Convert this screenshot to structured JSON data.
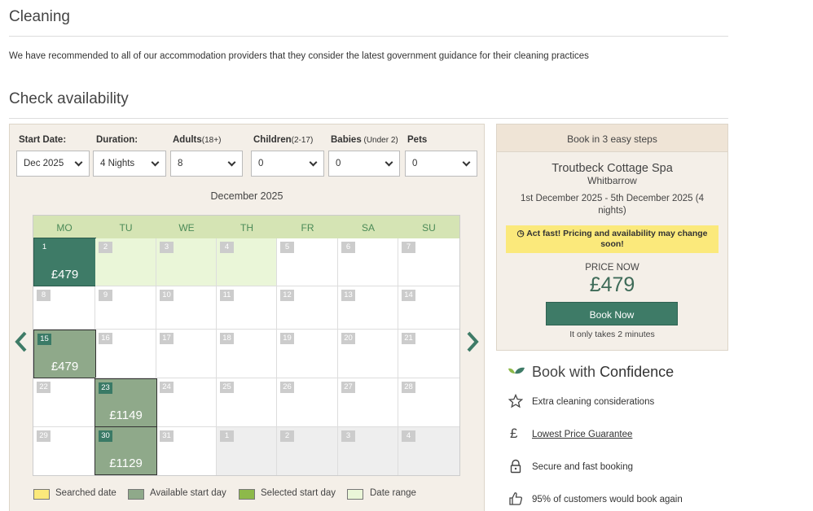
{
  "cleaning": {
    "title": "Cleaning",
    "text": "We have recommended to all of our accommodation providers that they consider the latest government guidance for their cleaning practices"
  },
  "availability": {
    "title": "Check availability",
    "filters": {
      "start_label": "Start Date:",
      "start_value": "Dec 2025",
      "duration_label": "Duration:",
      "duration_value": "4 Nights",
      "adults_label": "Adults",
      "adults_sub": "(18+)",
      "adults_value": "8",
      "children_label": "Children",
      "children_sub": "(2-17)",
      "children_value": "0",
      "babies_label": "Babies",
      "babies_sub": " (Under 2)",
      "babies_value": "0",
      "pets_label": "Pets",
      "pets_value": "0"
    },
    "calendar": {
      "month": "December 2025",
      "days": [
        "MO",
        "TU",
        "WE",
        "TH",
        "FR",
        "SA",
        "SU"
      ],
      "prices": {
        "p1": "£479",
        "p15": "£479",
        "p23": "£1149",
        "p30": "£1129"
      }
    },
    "legend": {
      "searched": "Searched date",
      "available": "Available start day",
      "selected": "Selected start day",
      "range": "Date range"
    },
    "colors": {
      "accent": "#3e7b67",
      "searched": "#fbe97b",
      "available": "#8fa98a",
      "selected": "#8db94a",
      "range": "#eaf6d8"
    }
  },
  "booking": {
    "steps": "Book in 3 easy steps",
    "property": "Troutbeck Cottage Spa",
    "location": "Whitbarrow",
    "dates": "1st December 2025 - 5th December 2025 (4 nights)",
    "warning": "Act fast! Pricing and availability may change soon!",
    "price_label": "PRICE NOW",
    "price": "£479",
    "button": "Book Now",
    "note": "It only takes 2 minutes"
  },
  "confidence": {
    "title_pre": "Book with",
    "title_strong": "Confidence",
    "items": [
      "Extra cleaning considerations",
      "Lowest Price Guarantee",
      "Secure and fast booking",
      "95% of customers would book again"
    ]
  }
}
